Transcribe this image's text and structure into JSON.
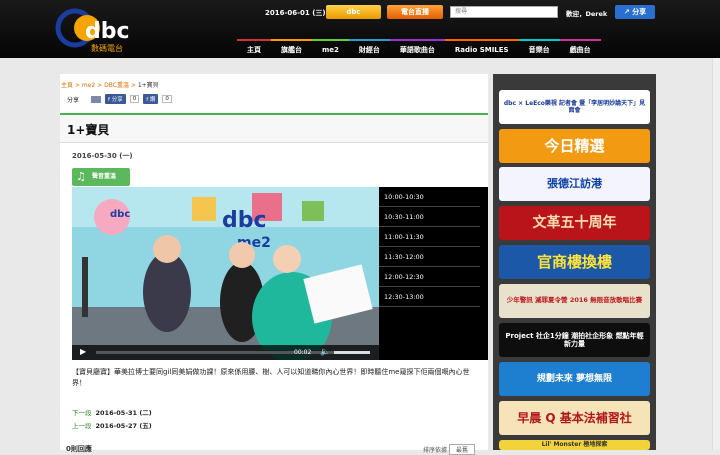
{
  "header": {
    "logo_text": "dbc",
    "logo_sub": "數碼電台",
    "date": "2016-06-01 (三)",
    "dbc_button": "dbc",
    "live_button": "電台直播",
    "search_placeholder": "搜尋",
    "welcome": "歡迎，Derek",
    "share_button": "分享"
  },
  "nav": [
    "主頁",
    "旗艦台",
    "me2",
    "財經台",
    "華語歌曲台",
    "Radio SMILES",
    "音樂台",
    "戲曲台"
  ],
  "breadcrumb": {
    "home": "主頁",
    "section": "me2",
    "sub": "DBC重溫",
    "current": "1+寶貝",
    "sep": ">"
  },
  "share": {
    "label": "分享",
    "fb_share": "分享",
    "share_count": "0",
    "fb_like": "讚",
    "like_count": "0"
  },
  "page_title": "1+寶貝",
  "program_date": "2016-05-30 (一)",
  "playback_label": "聲音重溫",
  "video": {
    "time": "00:02",
    "brand": "dbc",
    "channel": "me2"
  },
  "time_slots": [
    "10:00-10:30",
    "10:30-11:00",
    "11:00-11:30",
    "11:30-12:00",
    "12:00-12:30",
    "12:30-13:00"
  ],
  "description": "【寶貝廳寶】華美拉博士要同gil同美娟做功課！原來係用腰、樹、人可以知道睇你內心世界！即時聽住me窺探下佢兩個嘅內心世界！",
  "next_episode": {
    "label": "下一段",
    "date": "2016-05-31 (二)"
  },
  "prev_episode": {
    "label": "上一段",
    "date": "2016-05-27 (五)"
  },
  "comments_label": "0則回應",
  "sort": {
    "label": "排序依據",
    "value": "最舊"
  },
  "sidebar_banners": [
    {
      "text": "dbc × LeEco樂視 記者會 暨「李居明妙論天下」見面會",
      "bg": "#ffffff",
      "color": "#1a3a9a"
    },
    {
      "text": "今日精選",
      "bg": "#f29a12",
      "color": "#ffffff"
    },
    {
      "text": "張德江訪港",
      "bg": "#f4f4ff",
      "color": "#0b3ea8"
    },
    {
      "text": "文革五十周年",
      "bg": "#b8141a",
      "color": "#ffe0b0"
    },
    {
      "text": "官商樓換樓",
      "bg": "#1c58a8",
      "color": "#ffe23a"
    },
    {
      "text": "少年警訊 滅罪夏令營 2016 無限音放歌唱比賽",
      "bg": "#e8e2cc",
      "color": "#c0181f"
    },
    {
      "text": "Project 社企1分鐘 潮拍社企形象 燃點年輕新力量",
      "bg": "#0e0e0e",
      "color": "#ffffff"
    },
    {
      "text": "規劃未來 夢想無限",
      "bg": "#1e7fd0",
      "color": "#ffffff"
    },
    {
      "text": "早晨 Q 基本法補習社",
      "bg": "#f6e3b8",
      "color": "#b3151c"
    },
    {
      "text": "Lil' Monster 極地探索",
      "bg": "#f2d33a",
      "color": "#333333"
    }
  ]
}
